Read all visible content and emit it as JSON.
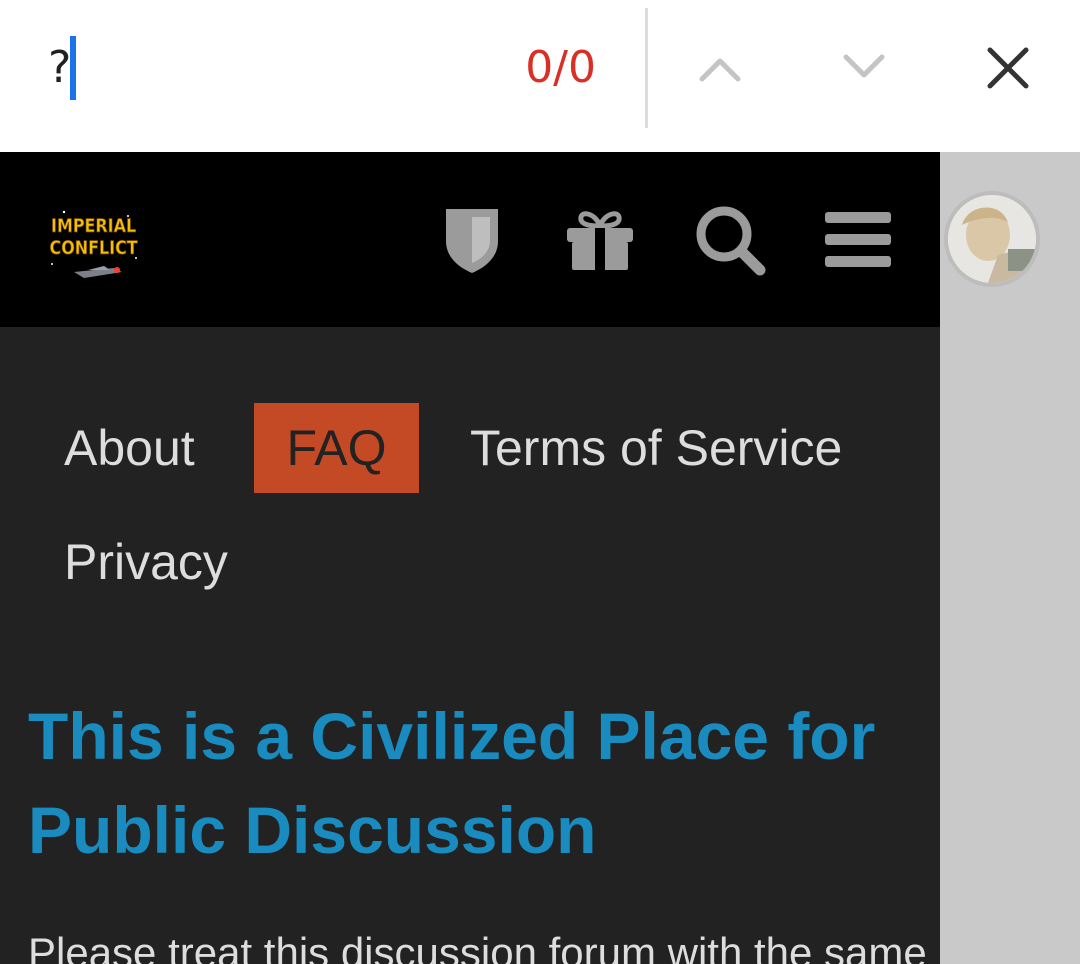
{
  "find_bar": {
    "query": "?",
    "match_count": "0/0",
    "icons": {
      "previous": "chevron-up-icon",
      "next": "chevron-down-icon",
      "close": "close-icon"
    }
  },
  "header": {
    "logo_text": "IMPERIAL CONFLICT",
    "icons": [
      "shield-icon",
      "gift-icon",
      "search-icon",
      "hamburger-menu-icon",
      "avatar"
    ]
  },
  "nav": {
    "about": "About",
    "faq": "FAQ",
    "terms": "Terms of Service",
    "privacy": "Privacy"
  },
  "content": {
    "title": "This is a Civilized Place for Public Discussion",
    "intro": "Please treat this discussion forum with the same"
  },
  "colors": {
    "accent_faq": "#c44a25",
    "title_blue": "#1a8bbf",
    "find_count_red": "#d93025",
    "caret_blue": "#1a73e8",
    "header_bg": "#000000",
    "content_bg": "#222222"
  }
}
